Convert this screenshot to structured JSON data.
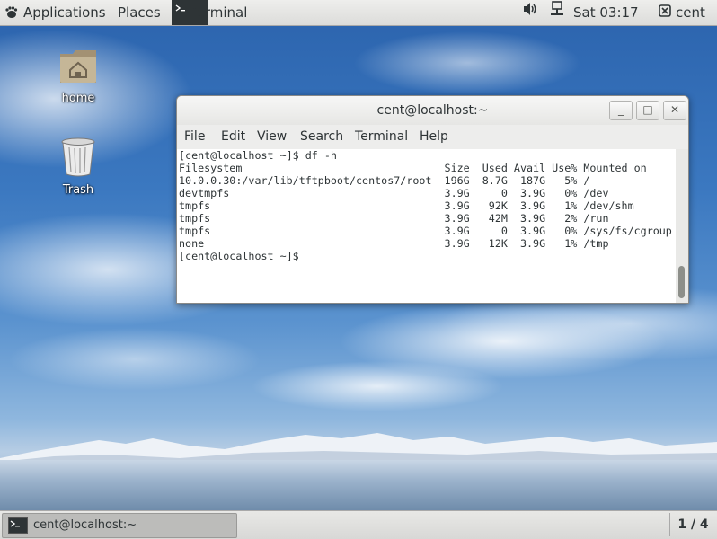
{
  "top_panel": {
    "applications_label": "Applications",
    "places_label": "Places",
    "terminal_label": "Terminal",
    "clock": "Sat 03:17",
    "user": "cent"
  },
  "desktop": {
    "icons": [
      {
        "label": "home",
        "icon": "home-folder-icon"
      },
      {
        "label": "Trash",
        "icon": "trash-icon"
      }
    ]
  },
  "terminal_window": {
    "title": "cent@localhost:~",
    "menu": [
      "File",
      "Edit",
      "View",
      "Search",
      "Terminal",
      "Help"
    ],
    "content": "[cent@localhost ~]$ df -h\nFilesystem                                Size  Used Avail Use% Mounted on\n10.0.0.30:/var/lib/tftpboot/centos7/root  196G  8.7G  187G   5% /\ndevtmpfs                                  3.9G     0  3.9G   0% /dev\ntmpfs                                     3.9G   92K  3.9G   1% /dev/shm\ntmpfs                                     3.9G   42M  3.9G   2% /run\ntmpfs                                     3.9G     0  3.9G   0% /sys/fs/cgroup\nnone                                      3.9G   12K  3.9G   1% /tmp\n[cent@localhost ~]$"
  },
  "bottom_panel": {
    "task_label": "cent@localhost:~",
    "workspace": "1 / 4"
  }
}
